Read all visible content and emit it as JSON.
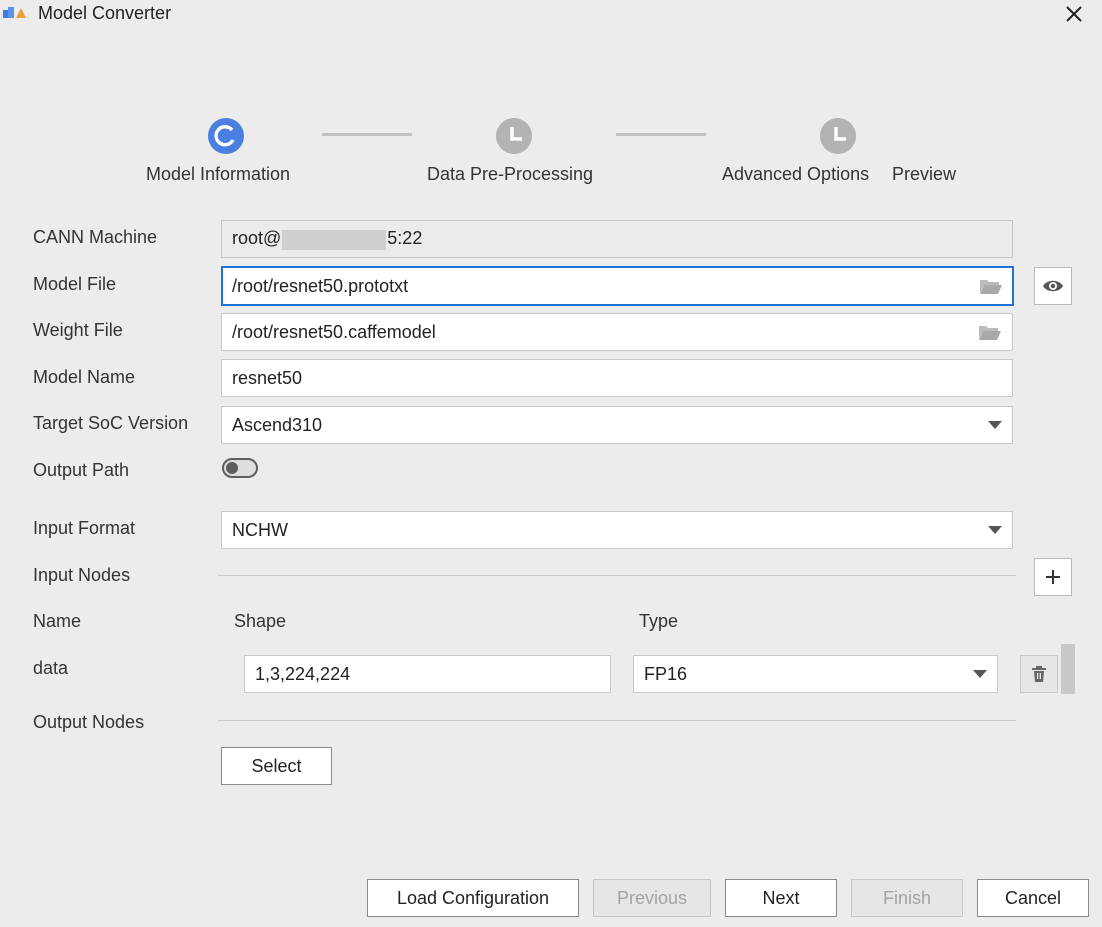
{
  "window": {
    "title": "Model Converter"
  },
  "steps": [
    {
      "label": "Model Information",
      "state": "active"
    },
    {
      "label": "Data Pre-Processing",
      "state": "pending"
    },
    {
      "label": "Advanced Options",
      "state": "pending"
    },
    {
      "label": "Preview",
      "state": "pending"
    }
  ],
  "form": {
    "cann_machine": {
      "label": "CANN Machine",
      "value_prefix": "root@",
      "value_suffix": "5:22"
    },
    "model_file": {
      "label": "Model File",
      "value": "/root/resnet50.prototxt"
    },
    "weight_file": {
      "label": "Weight File",
      "value": "/root/resnet50.caffemodel"
    },
    "model_name": {
      "label": "Model Name",
      "value": "resnet50"
    },
    "target_soc": {
      "label": "Target SoC Version",
      "value": "Ascend310"
    },
    "output_path": {
      "label": "Output Path",
      "enabled": false
    },
    "input_format": {
      "label": "Input Format",
      "value": "NCHW"
    },
    "input_nodes": {
      "label": "Input Nodes",
      "columns": {
        "name": "Name",
        "shape": "Shape",
        "type": "Type"
      },
      "rows": [
        {
          "name": "data",
          "shape": "1,3,224,224",
          "type": "FP16"
        }
      ]
    },
    "output_nodes": {
      "label": "Output Nodes",
      "select_label": "Select"
    }
  },
  "footer": {
    "load_config": "Load Configuration",
    "previous": "Previous",
    "next": "Next",
    "finish": "Finish",
    "cancel": "Cancel"
  },
  "colors": {
    "accent": "#4a7fe0",
    "pending": "#b3b3b3",
    "focus_border": "#1f74d6"
  }
}
